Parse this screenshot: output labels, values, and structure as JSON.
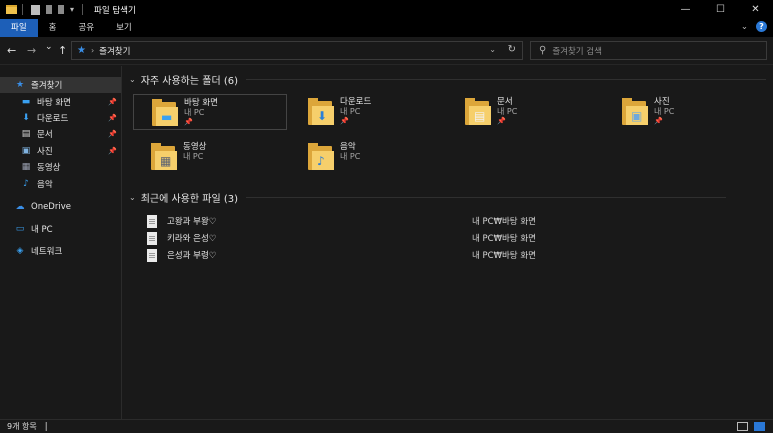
{
  "window": {
    "title": "파일 탐색기",
    "controls": {
      "minimize": "—",
      "maximize": "☐",
      "close": "✕"
    }
  },
  "ribbon": {
    "tabs": [
      {
        "label": "파일",
        "active": true
      },
      {
        "label": "홈",
        "active": false
      },
      {
        "label": "공유",
        "active": false
      },
      {
        "label": "보기",
        "active": false
      }
    ],
    "expand_icon": "chevron-down-icon",
    "help": "?"
  },
  "nav": {
    "back": "←",
    "forward": "→",
    "recent": "⌄",
    "up": "↑",
    "address": "즐겨찾기",
    "search_placeholder": "즐겨찾기 검색"
  },
  "sidebar": {
    "items": [
      {
        "label": "즐겨찾기",
        "icon": "star-icon",
        "glyph": "★",
        "color": "#3a8ee6",
        "pinned": false,
        "selected": true
      },
      {
        "label": "바탕 화면",
        "icon": "desktop-icon",
        "glyph": "▬",
        "color": "#3aa0f0",
        "pinned": true,
        "selected": false
      },
      {
        "label": "다운로드",
        "icon": "download-icon",
        "glyph": "⬇",
        "color": "#3aa0f0",
        "pinned": true,
        "selected": false
      },
      {
        "label": "문서",
        "icon": "document-icon",
        "glyph": "▤",
        "color": "#d8d8d8",
        "pinned": true,
        "selected": false
      },
      {
        "label": "사진",
        "icon": "picture-icon",
        "glyph": "▣",
        "color": "#7fb2e0",
        "pinned": true,
        "selected": false
      },
      {
        "label": "동영상",
        "icon": "video-icon",
        "glyph": "▦",
        "color": "#9aa0b0",
        "pinned": false,
        "selected": false
      },
      {
        "label": "음악",
        "icon": "music-icon",
        "glyph": "♪",
        "color": "#3aa0f0",
        "pinned": false,
        "selected": false
      },
      {
        "label": "OneDrive",
        "icon": "cloud-icon",
        "glyph": "☁",
        "color": "#3a8ee6",
        "pinned": false,
        "selected": false
      },
      {
        "label": "내 PC",
        "icon": "computer-icon",
        "glyph": "▭",
        "color": "#3aa0f0",
        "pinned": false,
        "selected": false
      },
      {
        "label": "네트워크",
        "icon": "network-icon",
        "glyph": "◈",
        "color": "#3aa0f0",
        "pinned": false,
        "selected": false
      }
    ],
    "pin_glyph": "📌"
  },
  "frequent": {
    "header": "자주 사용하는 폴더 (6)",
    "folders": [
      {
        "name": "바탕 화면",
        "location": "내 PC",
        "pinned": true,
        "overlay": "desktop-icon",
        "glyph": "▬",
        "color": "#3aa0f0",
        "selected": true
      },
      {
        "name": "다운로드",
        "location": "내 PC",
        "pinned": true,
        "overlay": "download-icon",
        "glyph": "⬇",
        "color": "#2a7fd8",
        "selected": false
      },
      {
        "name": "문서",
        "location": "내 PC",
        "pinned": true,
        "overlay": "document-icon",
        "glyph": "▤",
        "color": "#f2f2f2",
        "selected": false
      },
      {
        "name": "사진",
        "location": "내 PC",
        "pinned": true,
        "overlay": "picture-icon",
        "glyph": "▣",
        "color": "#6fa8dc",
        "selected": false
      },
      {
        "name": "동영상",
        "location": "내 PC",
        "pinned": false,
        "overlay": "video-icon",
        "glyph": "▦",
        "color": "#5b6272",
        "selected": false
      },
      {
        "name": "음악",
        "location": "내 PC",
        "pinned": false,
        "overlay": "music-icon",
        "glyph": "♪",
        "color": "#2a7fd8",
        "selected": false
      }
    ]
  },
  "recent": {
    "header": "최근에 사용한 파일 (3)",
    "files": [
      {
        "name": "고왕과 부왕♡",
        "path": "내 PC₩바탕 화면"
      },
      {
        "name": "키라와 은성♡",
        "path": "내 PC₩바탕 화면"
      },
      {
        "name": "은성과 부령♡",
        "path": "내 PC₩바탕 화면"
      }
    ]
  },
  "status": {
    "count": "9개 항목"
  }
}
